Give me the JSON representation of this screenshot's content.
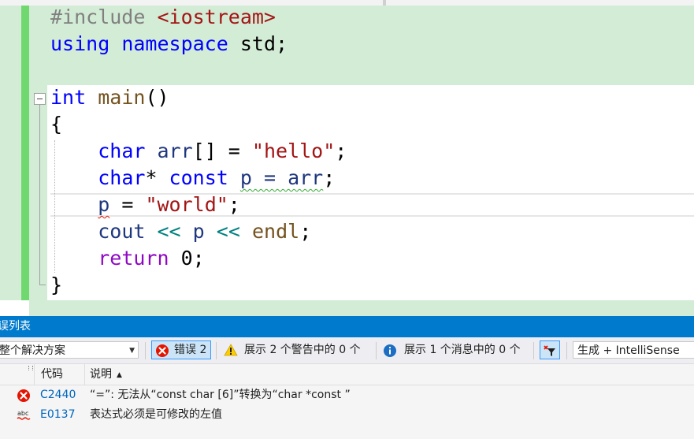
{
  "editor": {
    "lines": [
      {
        "id": "l1",
        "parts": [
          {
            "t": "#include ",
            "c": "pp"
          },
          {
            "t": "<iostream>",
            "c": "inc"
          }
        ]
      },
      {
        "id": "l2",
        "parts": [
          {
            "t": "using",
            "c": "kw"
          },
          {
            "t": " "
          },
          {
            "t": "namespace",
            "c": "kw"
          },
          {
            "t": " std;"
          }
        ]
      },
      {
        "id": "l3",
        "parts": []
      },
      {
        "id": "l4",
        "parts": [
          {
            "t": "int",
            "c": "kw"
          },
          {
            "t": " "
          },
          {
            "t": "main",
            "c": "fn"
          },
          {
            "t": "()"
          }
        ]
      },
      {
        "id": "l5",
        "parts": [
          {
            "t": "{"
          }
        ]
      },
      {
        "id": "l6",
        "parts": [
          {
            "t": "    "
          },
          {
            "t": "char",
            "c": "kw"
          },
          {
            "t": " "
          },
          {
            "t": "arr",
            "c": "var"
          },
          {
            "t": "[] = "
          },
          {
            "t": "\"hello\"",
            "c": "str"
          },
          {
            "t": ";"
          }
        ]
      },
      {
        "id": "l7",
        "parts": [
          {
            "t": "    "
          },
          {
            "t": "char",
            "c": "kw"
          },
          {
            "t": "* "
          },
          {
            "t": "const",
            "c": "kw"
          },
          {
            "t": " "
          },
          {
            "t": "p = arr",
            "c": "var squig-green"
          },
          {
            "t": ";"
          }
        ]
      },
      {
        "id": "l8",
        "parts": [
          {
            "t": "    "
          },
          {
            "t": "p",
            "c": "var squig-red"
          },
          {
            "t": " = "
          },
          {
            "t": "\"world\"",
            "c": "str"
          },
          {
            "t": ";"
          }
        ]
      },
      {
        "id": "l9",
        "parts": [
          {
            "t": "    "
          },
          {
            "t": "cout",
            "c": "var"
          },
          {
            "t": " "
          },
          {
            "t": "<<",
            "c": "op"
          },
          {
            "t": " "
          },
          {
            "t": "p",
            "c": "var"
          },
          {
            "t": " "
          },
          {
            "t": "<<",
            "c": "op"
          },
          {
            "t": " "
          },
          {
            "t": "endl",
            "c": "fn"
          },
          {
            "t": ";"
          }
        ]
      },
      {
        "id": "l10",
        "parts": [
          {
            "t": "    "
          },
          {
            "t": "return",
            "c": "ctl"
          },
          {
            "t": " 0;"
          }
        ]
      },
      {
        "id": "l11",
        "parts": [
          {
            "t": "}"
          }
        ]
      }
    ]
  },
  "error_list": {
    "title": "误列表",
    "scope": "整个解决方案",
    "errors_label": "错误 2",
    "warnings_label": "展示 2 个警告中的 0 个",
    "messages_label": "展示 1 个消息中的 0 个",
    "build_filter": "生成 + IntelliSense",
    "columns": {
      "code": "代码",
      "description": "说明"
    },
    "rows": [
      {
        "icon": "error-icon",
        "code": "C2440",
        "description": "“=”: 无法从“const char [6]”转换为“char *const ”"
      },
      {
        "icon": "intellisense-error-icon",
        "code": "E0137",
        "description": "表达式必须是可修改的左值"
      }
    ]
  },
  "colors": {
    "accent": "#007acc",
    "keyword": "#0000ff",
    "string": "#a31515",
    "change_margin": "#6fd96f",
    "error": "#e51400"
  }
}
